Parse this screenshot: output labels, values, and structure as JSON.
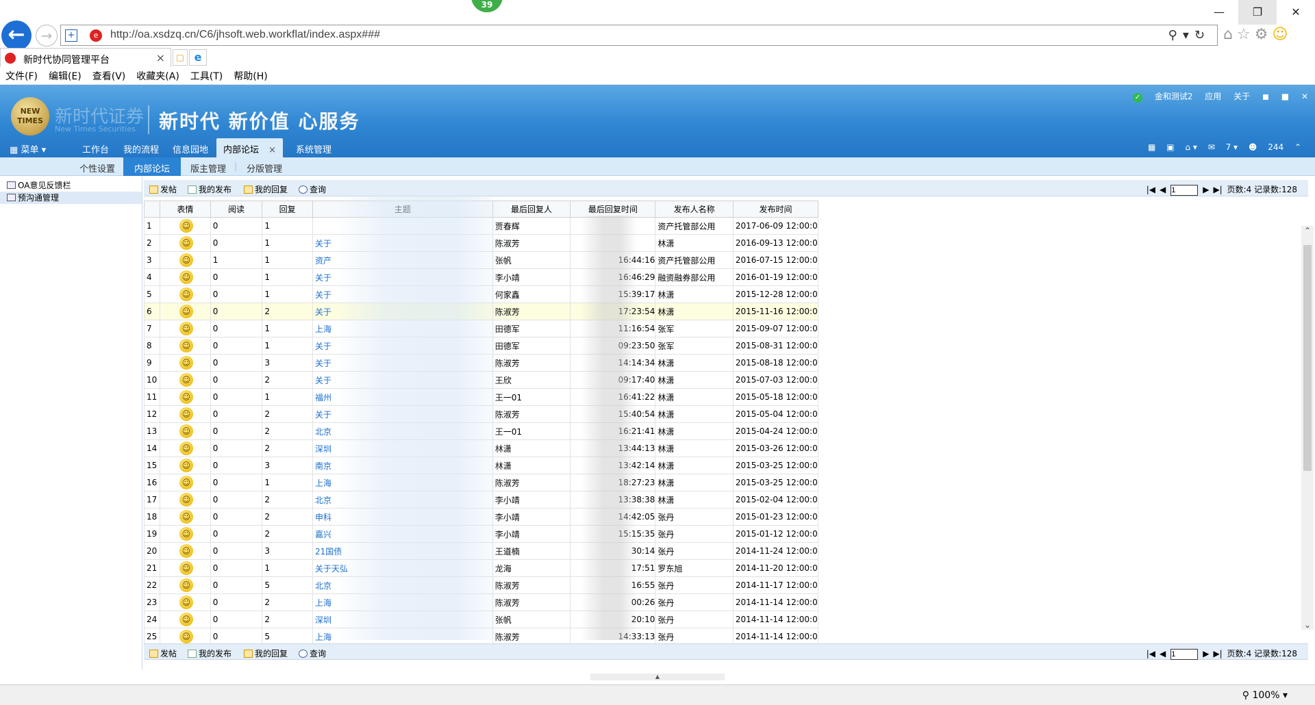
{
  "browser": {
    "badge": "39",
    "url": "http://oa.xsdzq.cn/C6/jhsoft.web.workflat/index.aspx###",
    "tab_title": "新时代协同管理平台",
    "menu": [
      "文件(F)",
      "编辑(E)",
      "查看(V)",
      "收藏夹(A)",
      "工具(T)",
      "帮助(H)"
    ],
    "zoom": "100%"
  },
  "header": {
    "logo_text": "NEW TIMES",
    "company_cn": "新时代证券",
    "company_en": "New Times Securities",
    "slogan": "新时代 新价值 心服务",
    "user": "金和测试2",
    "apps_label": "应用",
    "about_label": "关于",
    "menu_label": "菜单",
    "nav": [
      "工作台",
      "我的流程",
      "信息园地",
      "内部论坛",
      "系统管理"
    ],
    "active_nav": "内部论坛",
    "msg_count": "7",
    "online_count": "244"
  },
  "subnav": [
    "个性设置",
    "内部论坛",
    "版主管理",
    "分版管理"
  ],
  "sidebar": [
    "OA意见反馈栏",
    "预沟通管理"
  ],
  "toolbar": {
    "post": "发帖",
    "my_posts": "我的发布",
    "my_replies": "我的回复",
    "search": "查询",
    "page": "1",
    "pages_label": "页数:4 记录数:128"
  },
  "columns": [
    "",
    "表情",
    "阅读",
    "回复",
    "主题",
    "最后回复人",
    "最后回复时间",
    "发布人名称",
    "发布时间"
  ],
  "rows": [
    {
      "n": "1",
      "read": "0",
      "reply": "1",
      "subject": "",
      "last": "贾春辉",
      "lasttime": "",
      "author": "资产托管部公用",
      "time": "2017-06-09 12:00:00"
    },
    {
      "n": "2",
      "read": "0",
      "reply": "1",
      "subject": "关于",
      "last": "陈淑芳",
      "lasttime": "",
      "author": "林潇",
      "time": "2016-09-13 12:00:00"
    },
    {
      "n": "3",
      "read": "1",
      "reply": "1",
      "subject": "资产",
      "last": "张帆",
      "lasttime": "16:44:16",
      "author": "资产托管部公用",
      "time": "2016-07-15 12:00:00"
    },
    {
      "n": "4",
      "read": "0",
      "reply": "1",
      "subject": "关于",
      "last": "李小靖",
      "lasttime": "16:46:29",
      "author": "融资融券部公用",
      "time": "2016-01-19 12:00:00"
    },
    {
      "n": "5",
      "read": "0",
      "reply": "1",
      "subject": "关于",
      "last": "何家鑫",
      "lasttime": "15:39:17",
      "author": "林潇",
      "time": "2015-12-28 12:00:00"
    },
    {
      "n": "6",
      "read": "0",
      "reply": "2",
      "subject": "关于",
      "last": "陈淑芳",
      "lasttime": "17:23:54",
      "author": "林潇",
      "time": "2015-11-16 12:00:00"
    },
    {
      "n": "7",
      "read": "0",
      "reply": "1",
      "subject": "上海",
      "last": "田德军",
      "lasttime": "11:16:54",
      "author": "张军",
      "time": "2015-09-07 12:00:00"
    },
    {
      "n": "8",
      "read": "0",
      "reply": "1",
      "subject": "关于",
      "last": "田德军",
      "lasttime": "09:23:50",
      "author": "张军",
      "time": "2015-08-31 12:00:00"
    },
    {
      "n": "9",
      "read": "0",
      "reply": "3",
      "subject": "关于",
      "last": "陈淑芳",
      "lasttime": "14:14:34",
      "author": "林潇",
      "time": "2015-08-18 12:00:00"
    },
    {
      "n": "10",
      "read": "0",
      "reply": "2",
      "subject": "关于",
      "last": "王欣",
      "lasttime": "09:17:40",
      "author": "林潇",
      "time": "2015-07-03 12:00:00"
    },
    {
      "n": "11",
      "read": "0",
      "reply": "1",
      "subject": "福州",
      "last": "王一01",
      "lasttime": "16:41:22",
      "author": "林潇",
      "time": "2015-05-18 12:00:00"
    },
    {
      "n": "12",
      "read": "0",
      "reply": "2",
      "subject": "关于",
      "last": "陈淑芳",
      "lasttime": "15:40:54",
      "author": "林潇",
      "time": "2015-05-04 12:00:00"
    },
    {
      "n": "13",
      "read": "0",
      "reply": "2",
      "subject": "北京",
      "last": "王一01",
      "lasttime": "16:21:41",
      "author": "林潇",
      "time": "2015-04-24 12:00:00"
    },
    {
      "n": "14",
      "read": "0",
      "reply": "2",
      "subject": "深圳",
      "last": "林潇",
      "lasttime": "13:44:13",
      "author": "林潇",
      "time": "2015-03-26 12:00:00"
    },
    {
      "n": "15",
      "read": "0",
      "reply": "3",
      "subject": "南京",
      "last": "林潇",
      "lasttime": "13:42:14",
      "author": "林潇",
      "time": "2015-03-25 12:00:00"
    },
    {
      "n": "16",
      "read": "0",
      "reply": "1",
      "subject": "上海",
      "last": "陈淑芳",
      "lasttime": "18:27:23",
      "author": "林潇",
      "time": "2015-03-25 12:00:00"
    },
    {
      "n": "17",
      "read": "0",
      "reply": "2",
      "subject": "北京",
      "last": "李小靖",
      "lasttime": "13:38:38",
      "author": "林潇",
      "time": "2015-02-04 12:00:00"
    },
    {
      "n": "18",
      "read": "0",
      "reply": "2",
      "subject": "申科",
      "last": "李小靖",
      "lasttime": "14:42:05",
      "author": "张丹",
      "time": "2015-01-23 12:00:00"
    },
    {
      "n": "19",
      "read": "0",
      "reply": "2",
      "subject": "嘉兴",
      "last": "李小靖",
      "lasttime": "15:15:35",
      "author": "张丹",
      "time": "2015-01-12 12:00:00"
    },
    {
      "n": "20",
      "read": "0",
      "reply": "3",
      "subject": "21国债",
      "last": "王道楠",
      "lasttime": "30:14",
      "author": "张丹",
      "time": "2014-11-24 12:00:00"
    },
    {
      "n": "21",
      "read": "0",
      "reply": "1",
      "subject": "关于天弘",
      "last": "龙海",
      "lasttime": "17:51",
      "author": "罗东旭",
      "time": "2014-11-20 12:00:00"
    },
    {
      "n": "22",
      "read": "0",
      "reply": "5",
      "subject": "北京",
      "last": "陈淑芳",
      "lasttime": "16:55",
      "author": "张丹",
      "time": "2014-11-17 12:00:00"
    },
    {
      "n": "23",
      "read": "0",
      "reply": "2",
      "subject": "上海",
      "last": "陈淑芳",
      "lasttime": "00:26",
      "author": "张丹",
      "time": "2014-11-14 12:00:00"
    },
    {
      "n": "24",
      "read": "0",
      "reply": "2",
      "subject": "深圳",
      "last": "张帆",
      "lasttime": "20:10",
      "author": "张丹",
      "time": "2014-11-14 12:00:00"
    },
    {
      "n": "25",
      "read": "0",
      "reply": "5",
      "subject": "上海",
      "last": "陈淑芳",
      "lasttime": "14:33:13",
      "author": "张丹",
      "time": "2014-11-14 12:00:00"
    }
  ]
}
